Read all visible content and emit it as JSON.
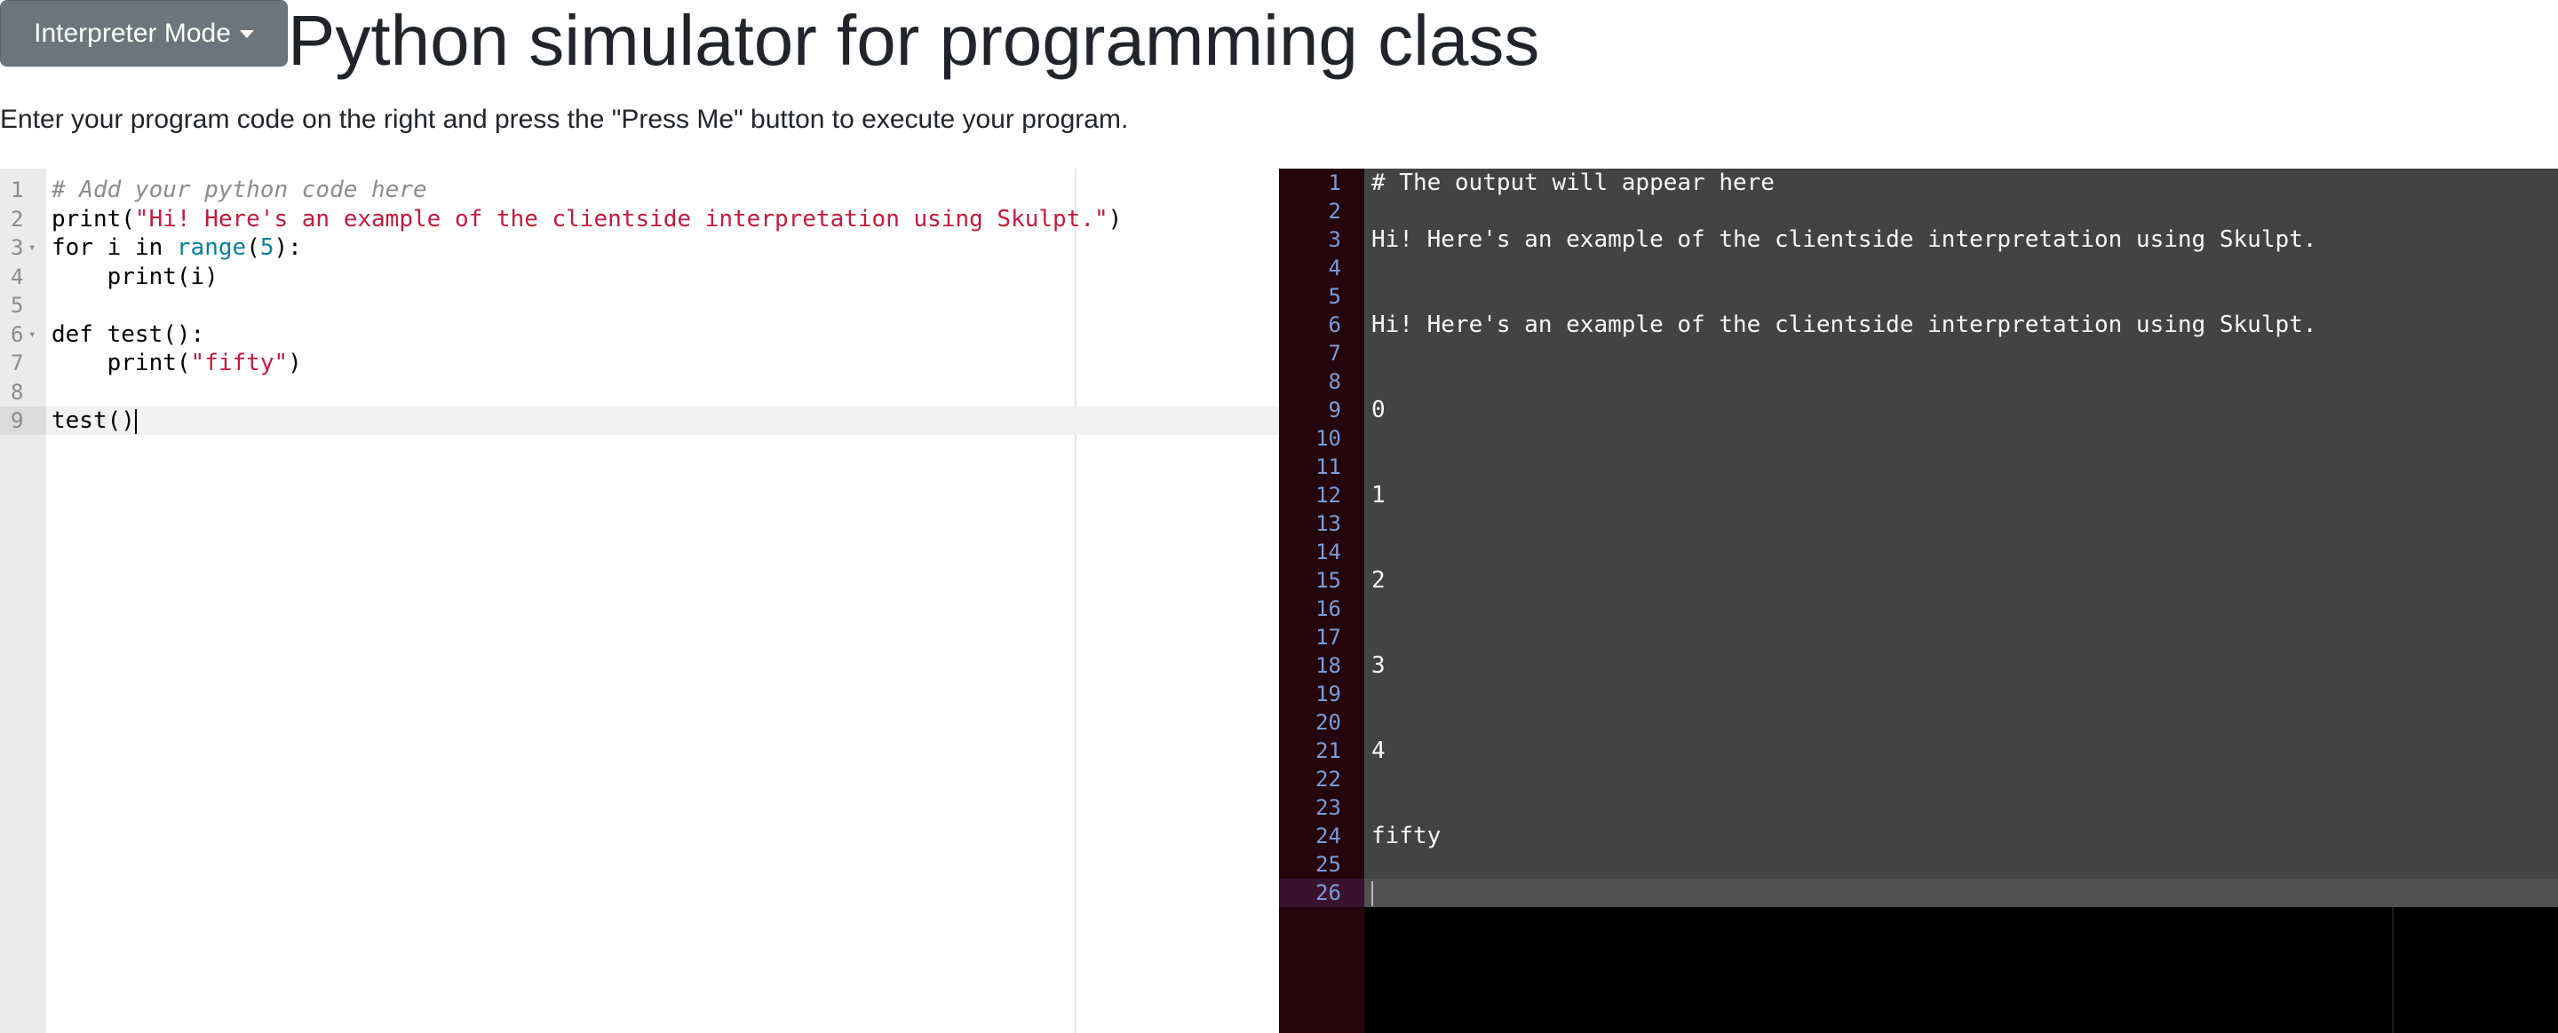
{
  "header": {
    "mode_button_label": "Interpreter Mode",
    "mode_button_icon": "chevron-down-icon",
    "title": "Python simulator for programming class",
    "intro": "Enter your program code on the right and press the \"Press Me\" button to execute your program."
  },
  "editor": {
    "lines": [
      {
        "number": "1",
        "tokens": [
          {
            "type": "comment",
            "text": "# Add your python code here"
          }
        ]
      },
      {
        "number": "2",
        "tokens": [
          {
            "type": "plain",
            "text": "print("
          },
          {
            "type": "string",
            "text": "\"Hi! Here's an example of the clientside interpretation using Skulpt.\""
          },
          {
            "type": "plain",
            "text": ")"
          }
        ]
      },
      {
        "number": "3",
        "fold": true,
        "tokens": [
          {
            "type": "keyword",
            "text": "for"
          },
          {
            "type": "plain",
            "text": " i "
          },
          {
            "type": "keyword",
            "text": "in"
          },
          {
            "type": "plain",
            "text": " "
          },
          {
            "type": "builtin",
            "text": "range"
          },
          {
            "type": "plain",
            "text": "("
          },
          {
            "type": "number",
            "text": "5"
          },
          {
            "type": "plain",
            "text": "):"
          }
        ]
      },
      {
        "number": "4",
        "tokens": [
          {
            "type": "plain",
            "text": "    print(i)"
          }
        ]
      },
      {
        "number": "5",
        "tokens": []
      },
      {
        "number": "6",
        "fold": true,
        "tokens": [
          {
            "type": "keyword",
            "text": "def"
          },
          {
            "type": "plain",
            "text": " test():"
          }
        ]
      },
      {
        "number": "7",
        "tokens": [
          {
            "type": "plain",
            "text": "    print("
          },
          {
            "type": "string",
            "text": "\"fifty\""
          },
          {
            "type": "plain",
            "text": ")"
          }
        ]
      },
      {
        "number": "8",
        "tokens": []
      },
      {
        "number": "9",
        "active": true,
        "tokens": [
          {
            "type": "plain",
            "text": "test()"
          }
        ]
      }
    ]
  },
  "output": {
    "lines": [
      {
        "number": "1",
        "text": "# The output will appear here"
      },
      {
        "number": "2",
        "text": ""
      },
      {
        "number": "3",
        "text": "Hi! Here's an example of the clientside interpretation using Skulpt."
      },
      {
        "number": "4",
        "text": ""
      },
      {
        "number": "5",
        "text": ""
      },
      {
        "number": "6",
        "text": "Hi! Here's an example of the clientside interpretation using Skulpt."
      },
      {
        "number": "7",
        "text": ""
      },
      {
        "number": "8",
        "text": ""
      },
      {
        "number": "9",
        "text": "0"
      },
      {
        "number": "10",
        "text": ""
      },
      {
        "number": "11",
        "text": ""
      },
      {
        "number": "12",
        "text": "1"
      },
      {
        "number": "13",
        "text": ""
      },
      {
        "number": "14",
        "text": ""
      },
      {
        "number": "15",
        "text": "2"
      },
      {
        "number": "16",
        "text": ""
      },
      {
        "number": "17",
        "text": ""
      },
      {
        "number": "18",
        "text": "3"
      },
      {
        "number": "19",
        "text": ""
      },
      {
        "number": "20",
        "text": ""
      },
      {
        "number": "21",
        "text": "4"
      },
      {
        "number": "22",
        "text": ""
      },
      {
        "number": "23",
        "text": ""
      },
      {
        "number": "24",
        "text": "fifty"
      },
      {
        "number": "25",
        "text": ""
      },
      {
        "number": "26",
        "text": "",
        "active": true
      }
    ]
  }
}
